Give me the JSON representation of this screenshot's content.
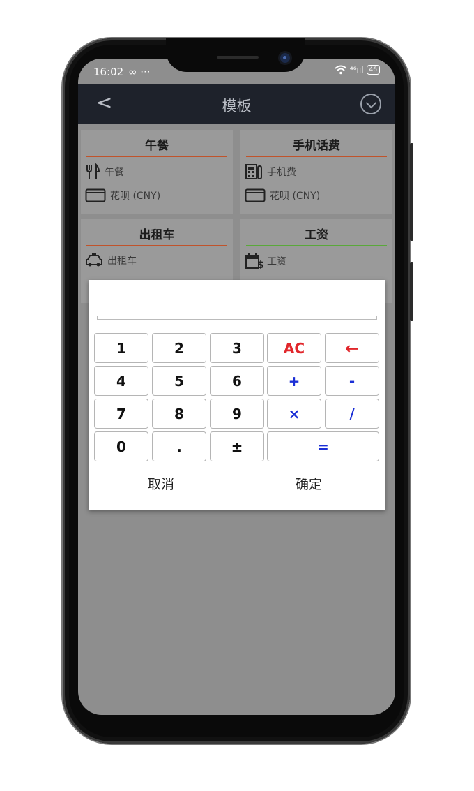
{
  "status_bar": {
    "time": "16:02",
    "extra": "∞ ···",
    "signal": "⁴⁶ııl",
    "battery": "46"
  },
  "header": {
    "back_icon": "back-chevron-icon",
    "title": "模板",
    "confirm_icon": "check-circle-icon"
  },
  "templates": [
    {
      "title": "午餐",
      "line_color": "#c0532b",
      "category": "午餐",
      "category_icon": "fork-knife-icon",
      "account": "花呗 (CNY)",
      "account_icon": "card-icon"
    },
    {
      "title": "手机话费",
      "line_color": "#c0532b",
      "category": "手机费",
      "category_icon": "phone-bill-icon",
      "account": "花呗 (CNY)",
      "account_icon": "card-icon"
    },
    {
      "title": "出租车",
      "line_color": "#c0532b",
      "category": "出租车",
      "category_icon": "taxi-icon",
      "account": "",
      "account_icon": "card-icon"
    },
    {
      "title": "工资",
      "line_color": "#5aa83a",
      "category": "工资",
      "category_icon": "salary-icon",
      "account": "",
      "account_icon": "bank-icon"
    }
  ],
  "calculator": {
    "display_value": "",
    "keys": [
      [
        "1",
        "2",
        "3",
        "AC",
        "←"
      ],
      [
        "4",
        "5",
        "6",
        "+",
        "-"
      ],
      [
        "7",
        "8",
        "9",
        "×",
        "/"
      ],
      [
        "0",
        ".",
        "±",
        "="
      ]
    ],
    "cancel_label": "取消",
    "confirm_label": "确定"
  },
  "colors": {
    "header_bg": "#1e222b",
    "overlay": "#8e8e8e",
    "operator_blue": "#1b2fd6",
    "action_red": "#e1262b"
  }
}
